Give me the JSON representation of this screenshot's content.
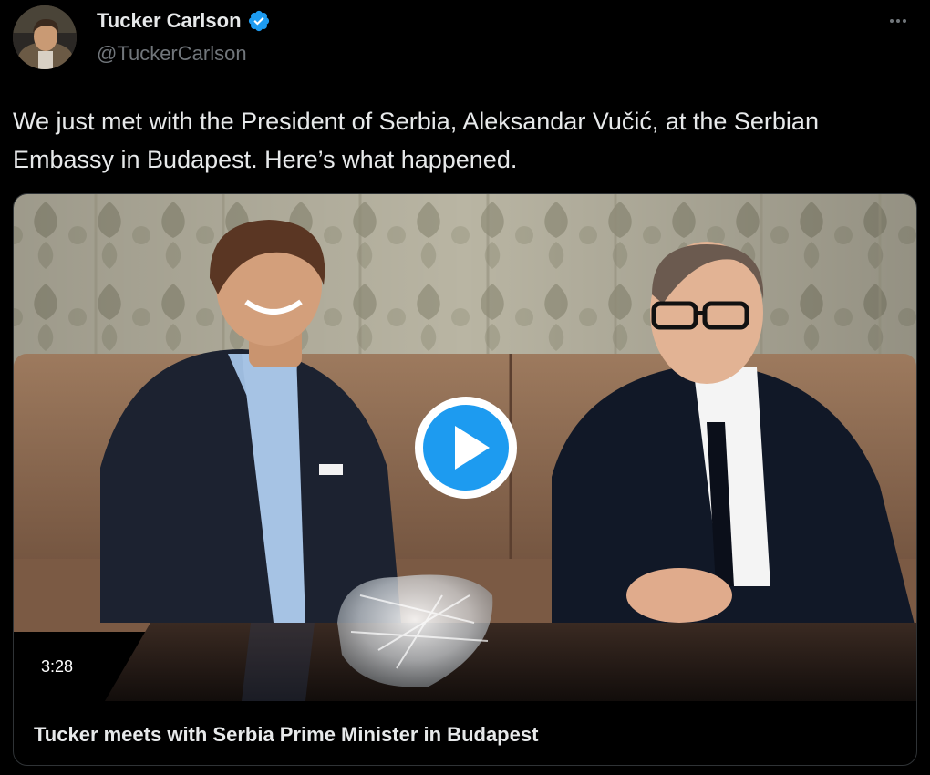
{
  "author": {
    "display_name": "Tucker Carlson",
    "handle": "@TuckerCarlson",
    "verified": true,
    "avatar_icon": "profile-photo"
  },
  "post": {
    "text": "We just met with the President of Serbia, Aleksandar Vučić, at the Serbian Embassy in Budapest. Here’s what happened."
  },
  "video": {
    "duration": "3:28",
    "title": "Tucker meets with Serbia Prime Minister in Budapest",
    "play_icon": "play-icon"
  },
  "colors": {
    "background": "#000000",
    "text_primary": "#e7e9ea",
    "text_secondary": "#71767b",
    "accent": "#1d9bf0",
    "border": "#2f3336"
  },
  "icons": {
    "more": "more-options-icon",
    "verified": "verified-badge-icon"
  }
}
